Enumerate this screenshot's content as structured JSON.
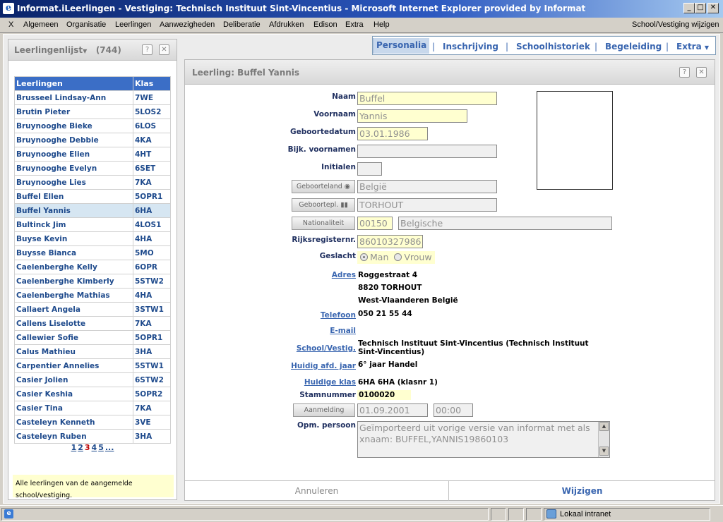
{
  "window": {
    "title": "Informat.iLeerlingen - Vestiging: Technisch Instituut Sint-Vincentius - Microsoft Internet Explorer provided by Informat"
  },
  "menu": {
    "close": "X",
    "items": [
      "Algemeen",
      "Organisatie",
      "Leerlingen",
      "Aanwezigheden",
      "Deliberatie",
      "Afdrukken",
      "Edison",
      "Extra",
      "Help"
    ],
    "right": "School/Vestiging wijzigen"
  },
  "left": {
    "title": "Leerlingenlijst",
    "count": "(744)",
    "help": "?",
    "close": "✕",
    "col_name": "Leerlingen",
    "col_class": "Klas",
    "rows": [
      {
        "name": "Brusseel Lindsay-Ann",
        "klas": "7WE"
      },
      {
        "name": "Brutin Pieter",
        "klas": "5LOS2"
      },
      {
        "name": "Bruynooghe Bieke",
        "klas": "6LOS"
      },
      {
        "name": "Bruynooghe Debbie",
        "klas": "4KA"
      },
      {
        "name": "Bruynooghe Elien",
        "klas": "4HT"
      },
      {
        "name": "Bruynooghe Evelyn",
        "klas": "6SET"
      },
      {
        "name": "Bruynooghe Lies",
        "klas": "7KA"
      },
      {
        "name": "Buffel Ellen",
        "klas": "5OPR1"
      },
      {
        "name": "Buffel Yannis",
        "klas": "6HA"
      },
      {
        "name": "Bultinck Jim",
        "klas": "4LOS1"
      },
      {
        "name": "Buyse Kevin",
        "klas": "4HA"
      },
      {
        "name": "Buysse Bianca",
        "klas": "5MO"
      },
      {
        "name": "Caelenberghe Kelly",
        "klas": "6OPR"
      },
      {
        "name": "Caelenberghe Kimberly",
        "klas": "5STW2"
      },
      {
        "name": "Caelenberghe Mathias",
        "klas": "4HA"
      },
      {
        "name": "Callaert Angela",
        "klas": "3STW1"
      },
      {
        "name": "Callens Liselotte",
        "klas": "7KA"
      },
      {
        "name": "Callewier Sofie",
        "klas": "5OPR1"
      },
      {
        "name": "Calus Mathieu",
        "klas": "3HA"
      },
      {
        "name": "Carpentier Annelies",
        "klas": "5STW1"
      },
      {
        "name": "Casier Jolien",
        "klas": "6STW2"
      },
      {
        "name": "Casier Keshia",
        "klas": "5OPR2"
      },
      {
        "name": "Casier Tina",
        "klas": "7KA"
      },
      {
        "name": "Casteleyn Kenneth",
        "klas": "3VE"
      },
      {
        "name": "Casteleyn Ruben",
        "klas": "3HA"
      }
    ],
    "selected_index": 8,
    "pages": [
      "1",
      "2",
      "3",
      "4",
      "5",
      "..."
    ],
    "current_page": "3",
    "note": "Alle leerlingen van de aangemelde school/vestiging."
  },
  "tabs": [
    "Personalia",
    "Inschrijving",
    "Schoolhistoriek",
    "Begeleiding",
    "Extra"
  ],
  "form": {
    "title": "Leerling: Buffel Yannis",
    "labels": {
      "naam": "Naam",
      "voornaam": "Voornaam",
      "geboortedatum": "Geboortedatum",
      "bijk": "Bijk. voornamen",
      "initialen": "Initialen",
      "rijks": "Rijksregisternr.",
      "geslacht": "Geslacht",
      "adres": "Adres",
      "telefoon": "Telefoon",
      "email": "E-mail",
      "school": "School/Vestig.",
      "afd": "Huidig afd. jaar",
      "klas": "Huidige klas",
      "stamnummer": "Stamnummer",
      "opm": "Opm. persoon"
    },
    "buttons": {
      "geboorteland": "Geboorteland",
      "geboortepl": "Geboortepl.",
      "nationaliteit": "Nationaliteit",
      "aanmelding": "Aanmelding"
    },
    "values": {
      "naam": "Buffel",
      "voornaam": "Yannis",
      "geboortedatum": "03.01.1986",
      "bijk": "",
      "initialen": "",
      "geboorteland": "België",
      "geboortepl": "TORHOUT",
      "nat_code": "00150",
      "nat_name": "Belgische",
      "rijks": "86010327986",
      "gender_man": "Man",
      "gender_vrouw": "Vrouw",
      "adres1": "Roggestraat 4",
      "adres2": "8820  TORHOUT",
      "adres3": "West-Vlaanderen België",
      "telefoon": "050 21 55 44",
      "school": "Technisch Instituut Sint-Vincentius (Technisch Instituut Sint-Vincentius)",
      "afd": "6° jaar Handel",
      "klas": "6HA  6HA (klasnr 1)",
      "stamnummer": "0100020",
      "aanmelding_date": "01.09.2001",
      "aanmelding_time": "00:00",
      "opm": "Geïmporteerd uit vorige versie van informat met als xnaam: BUFFEL,YANNIS19860103"
    },
    "cancel": "Annuleren",
    "save": "Wijzigen"
  },
  "status": {
    "zone": "Lokaal intranet"
  },
  "colors": {
    "header_blue": "#3b6ec6",
    "link_blue": "#3a66b0",
    "field_yellow": "#ffffd0"
  }
}
